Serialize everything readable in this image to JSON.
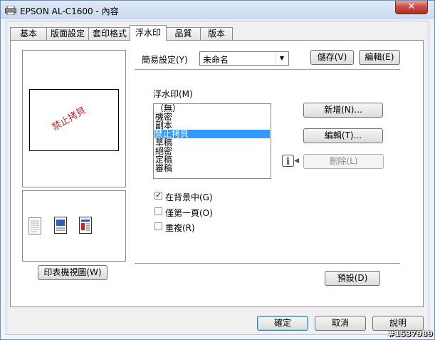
{
  "window": {
    "title": "EPSON AL-C1600 - 內容",
    "close_glyph": "✕"
  },
  "tabs": [
    {
      "label": "基本",
      "active": false
    },
    {
      "label": "版面設定",
      "active": false
    },
    {
      "label": "套印格式",
      "active": false
    },
    {
      "label": "浮水印",
      "active": true
    },
    {
      "label": "品質",
      "active": false
    },
    {
      "label": "版本",
      "active": false
    }
  ],
  "preview": {
    "watermark_text": "禁止拷貝",
    "watermark_color": "#c8262a",
    "printer_view_button": "印表機視圖(W)"
  },
  "easy_settings": {
    "label": "簡易設定(Y)",
    "value": "未命名",
    "save_button": "儲存(V)",
    "edit_button": "編輯(E)"
  },
  "watermark": {
    "label": "浮水印(M)",
    "items": [
      "（無）",
      "機密",
      "副本",
      "禁止拷貝",
      "草稿",
      "絕密",
      "定稿",
      "審稿"
    ],
    "selected_index": 3,
    "new_button": "新增(N)...",
    "edit_button": "編輯(T)...",
    "delete_button": "刪除(L)"
  },
  "options": {
    "background": {
      "label": "在背景中(G)",
      "checked": true
    },
    "first_page_only": {
      "label": "僅第一頁(O)",
      "checked": false
    },
    "repeat": {
      "label": "重複(R)",
      "checked": false
    }
  },
  "default_button": "預設(D)",
  "footer": {
    "ok": "確定",
    "cancel": "取消",
    "help": "說明"
  },
  "stamp": "#1537989",
  "colors": {
    "selection": "#3399ff",
    "accent": "#3c7fb1"
  }
}
